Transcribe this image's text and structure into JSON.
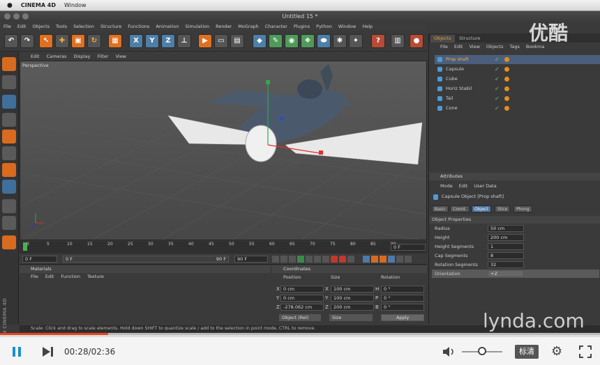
{
  "mac_menu": {
    "app": "CINEMA 4D",
    "items": [
      "Window"
    ]
  },
  "window_title": "Untitled 15 *",
  "main_menu": [
    "File",
    "Edit",
    "Objects",
    "Tools",
    "Selection",
    "Structure",
    "Functions",
    "Animation",
    "Simulation",
    "Render",
    "MoGraph",
    "Character",
    "Plugins",
    "Python",
    "Window",
    "Help"
  ],
  "viewport": {
    "menu": [
      "Edit",
      "Cameras",
      "Display",
      "Filter",
      "View"
    ],
    "label": "Perspective"
  },
  "timeline": {
    "ticks": [
      "0",
      "5",
      "10",
      "15",
      "20",
      "25",
      "30",
      "35",
      "40",
      "45",
      "50",
      "55",
      "60",
      "65",
      "70",
      "75",
      "80",
      "85",
      "90"
    ],
    "current_frame": "0 F",
    "start": "0 F",
    "range_start": "0 F",
    "range_end": "90 F",
    "end": "90 F"
  },
  "materials": {
    "title": "Materials",
    "menu": [
      "File",
      "Edit",
      "Function",
      "Texture"
    ]
  },
  "coordinates": {
    "title": "Coordinates",
    "headers": [
      "Position",
      "Size",
      "Rotation"
    ],
    "rows": [
      {
        "axis": "X",
        "pos": "0 cm",
        "size_axis": "X",
        "size": "100 cm",
        "rot_axis": "H",
        "rot": "0 °"
      },
      {
        "axis": "Y",
        "pos": "0 cm",
        "size_axis": "Y",
        "size": "100 cm",
        "rot_axis": "P",
        "rot": "0 °"
      },
      {
        "axis": "Z",
        "pos": "-278.062 cm",
        "size_axis": "Z",
        "size": "200 cm",
        "rot_axis": "B",
        "rot": "0 °"
      }
    ],
    "mode": "Object (Rel)",
    "size_mode": "Size",
    "apply": "Apply"
  },
  "objects_panel": {
    "tabs": [
      "Objects",
      "Structure"
    ],
    "menu": [
      "File",
      "Edit",
      "View",
      "Objects",
      "Tags",
      "Bookma"
    ],
    "items": [
      "Prop shaft",
      "Capsule",
      "Cube",
      "Horiz Stabil",
      "Tail",
      "Cone"
    ]
  },
  "attributes": {
    "title": "Attributes",
    "menu": [
      "Mode",
      "Edit",
      "User Data"
    ],
    "object": "Capsule Object [Prop shaft]",
    "tabs": [
      "Basic",
      "Coord.",
      "Object",
      "Slice",
      "Phong"
    ],
    "section": "Object Properties",
    "props": [
      {
        "name": "Radius",
        "value": "50 cm"
      },
      {
        "name": "Height",
        "value": "200 cm"
      },
      {
        "name": "Height Segments",
        "value": "1"
      },
      {
        "name": "Cap Segments",
        "value": "8"
      },
      {
        "name": "Rotation Segments",
        "value": "32"
      },
      {
        "name": "Orientation",
        "value": "+Z"
      }
    ]
  },
  "status": "Scale: Click and drag to scale elements. Hold down SHIFT to quantize scale / add to the selection in point mode, CTRL to remove.",
  "branding": {
    "maxon": "MAXON CINEMA 4D",
    "lynda": "lynda.com",
    "youku": "优酷"
  },
  "player": {
    "time": "00:28/02:36",
    "quality": "标清",
    "progress": 0.18,
    "volume": 0.5
  }
}
